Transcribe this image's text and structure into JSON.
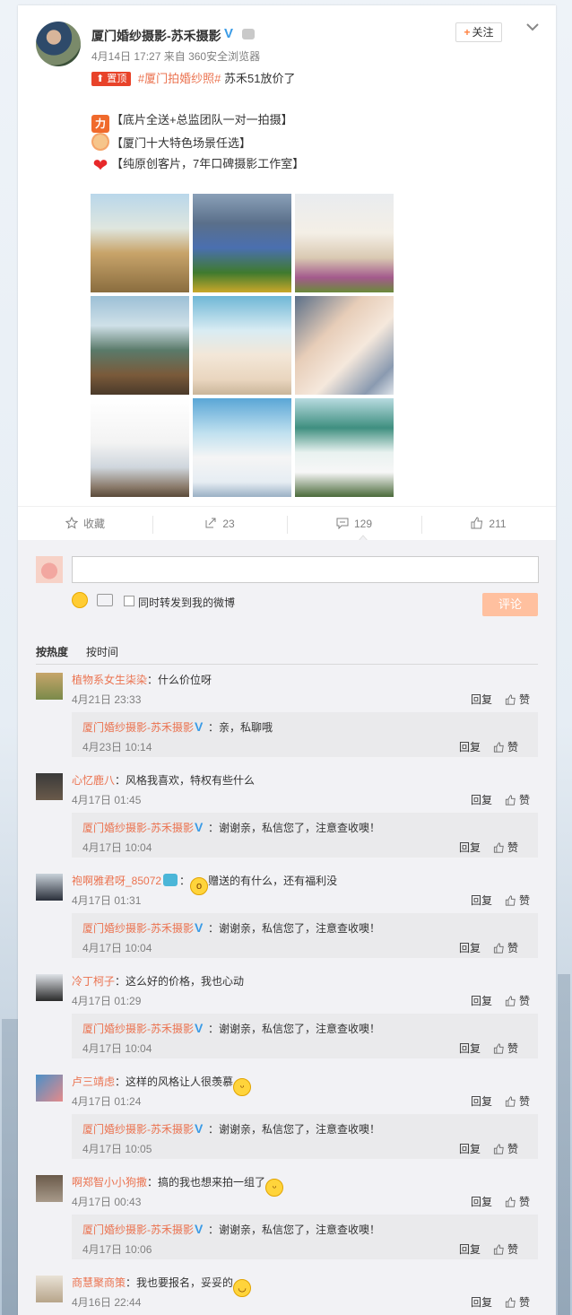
{
  "post": {
    "author": "厦门婚纱摄影-苏禾摄影",
    "follow_label": "关注",
    "follow_plus": "+",
    "date": "4月14日 17:27",
    "source": "来自 360安全浏览器",
    "pin_label": "置顶",
    "hashtag": "#厦门拍婚纱照#",
    "headline": "苏禾51放价了",
    "lines": [
      "【底片全送+总监团队一对一拍摄】",
      "【厦门十大特色场景任选】",
      "【纯原创客片，7年口碑摄影工作室】"
    ],
    "emoji_power": "力"
  },
  "actions": {
    "favorite": "收藏",
    "repost": "23",
    "comment": "129",
    "like": "211"
  },
  "composer": {
    "forward_label": "同时转发到我的微博",
    "submit_label": "评论",
    "sort_hot": "按热度",
    "sort_time": "按时间"
  },
  "ops": {
    "reply": "回复",
    "like": "赞"
  },
  "comments": [
    {
      "name": "植物系女生柒染",
      "text": "：什么价位呀",
      "time": "4月21日 23:33",
      "reply": {
        "name": "厦门婚纱摄影-苏禾摄影",
        "text": "：亲，私聊哦",
        "time": "4月23日 10:14"
      }
    },
    {
      "name": "心忆鹿八",
      "text": "：风格我喜欢，特权有些什么",
      "time": "4月17日 01:45",
      "reply": {
        "name": "厦门婚纱摄影-苏禾摄影",
        "text": "：谢谢亲，私信您了，注意查收噢！",
        "time": "4月17日 10:04"
      }
    },
    {
      "name": "袍啊雅君呀_85072",
      "text": "赠送的有什么，还有福利没",
      "time": "4月17日 01:31",
      "reply": {
        "name": "厦门婚纱摄影-苏禾摄影",
        "text": "：谢谢亲，私信您了，注意查收噢！",
        "time": "4月17日 10:04"
      }
    },
    {
      "name": "冷丁柯子",
      "text": "：这么好的价格，我也心动",
      "time": "4月17日 01:29",
      "reply": {
        "name": "厦门婚纱摄影-苏禾摄影",
        "text": "：谢谢亲，私信您了，注意查收噢！",
        "time": "4月17日 10:04"
      }
    },
    {
      "name": "卢三靖虑",
      "text": "：这样的风格让人很羡慕",
      "time": "4月17日 01:24",
      "reply": {
        "name": "厦门婚纱摄影-苏禾摄影",
        "text": "：谢谢亲，私信您了，注意查收噢！",
        "time": "4月17日 10:05"
      }
    },
    {
      "name": "啊郑智小小狗撒",
      "text": "：搞的我也想来拍一组了",
      "time": "4月17日 00:43",
      "reply": {
        "name": "厦门婚纱摄影-苏禾摄影",
        "text": "：谢谢亲，私信您了，注意查收噢！",
        "time": "4月17日 10:06"
      }
    },
    {
      "name": "商慧聚商策",
      "text": "：我也要报名，妥妥的",
      "time": "4月16日 22:44"
    }
  ],
  "colors": {
    "accent": "#eb7350",
    "verified": "#3a9be6",
    "submit": "#ffc09f",
    "pin": "#e8432a"
  }
}
